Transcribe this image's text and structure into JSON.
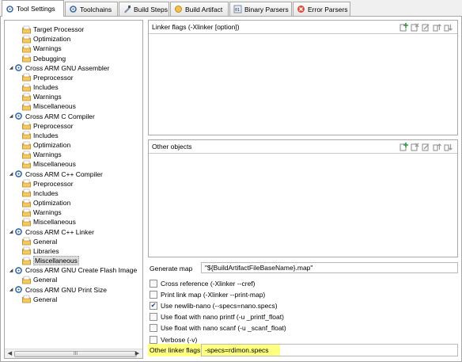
{
  "tabs": [
    {
      "label": "Tool Settings",
      "icon": "tool-settings-icon",
      "active": true
    },
    {
      "label": "Toolchains",
      "icon": "toolchains-icon",
      "active": false
    },
    {
      "label": "Build Steps",
      "icon": "build-steps-icon",
      "active": false
    },
    {
      "label": "Build Artifact",
      "icon": "build-artifact-icon",
      "active": false
    },
    {
      "label": "Binary Parsers",
      "icon": "binary-parsers-icon",
      "active": false
    },
    {
      "label": "Error Parsers",
      "icon": "error-parsers-icon",
      "active": false
    }
  ],
  "tree": [
    {
      "label": "Target Processor",
      "depth": 1,
      "kind": "option"
    },
    {
      "label": "Optimization",
      "depth": 1,
      "kind": "option"
    },
    {
      "label": "Warnings",
      "depth": 1,
      "kind": "option"
    },
    {
      "label": "Debugging",
      "depth": 1,
      "kind": "option"
    },
    {
      "label": "Cross ARM GNU Assembler",
      "depth": 0,
      "kind": "tool"
    },
    {
      "label": "Preprocessor",
      "depth": 1,
      "kind": "option"
    },
    {
      "label": "Includes",
      "depth": 1,
      "kind": "option"
    },
    {
      "label": "Warnings",
      "depth": 1,
      "kind": "option"
    },
    {
      "label": "Miscellaneous",
      "depth": 1,
      "kind": "option"
    },
    {
      "label": "Cross ARM C Compiler",
      "depth": 0,
      "kind": "tool"
    },
    {
      "label": "Preprocessor",
      "depth": 1,
      "kind": "option"
    },
    {
      "label": "Includes",
      "depth": 1,
      "kind": "option"
    },
    {
      "label": "Optimization",
      "depth": 1,
      "kind": "option"
    },
    {
      "label": "Warnings",
      "depth": 1,
      "kind": "option"
    },
    {
      "label": "Miscellaneous",
      "depth": 1,
      "kind": "option"
    },
    {
      "label": "Cross ARM C++ Compiler",
      "depth": 0,
      "kind": "tool"
    },
    {
      "label": "Preprocessor",
      "depth": 1,
      "kind": "option"
    },
    {
      "label": "Includes",
      "depth": 1,
      "kind": "option"
    },
    {
      "label": "Optimization",
      "depth": 1,
      "kind": "option"
    },
    {
      "label": "Warnings",
      "depth": 1,
      "kind": "option"
    },
    {
      "label": "Miscellaneous",
      "depth": 1,
      "kind": "option"
    },
    {
      "label": "Cross ARM C++ Linker",
      "depth": 0,
      "kind": "tool"
    },
    {
      "label": "General",
      "depth": 1,
      "kind": "option"
    },
    {
      "label": "Libraries",
      "depth": 1,
      "kind": "option"
    },
    {
      "label": "Miscellaneous",
      "depth": 1,
      "kind": "option",
      "selected": true
    },
    {
      "label": "Cross ARM GNU Create Flash Image",
      "depth": 0,
      "kind": "tool"
    },
    {
      "label": "General",
      "depth": 1,
      "kind": "option"
    },
    {
      "label": "Cross ARM GNU Print Size",
      "depth": 0,
      "kind": "tool"
    },
    {
      "label": "General",
      "depth": 1,
      "kind": "option"
    }
  ],
  "tree_scroll": {
    "grip": "III"
  },
  "linker_flags": {
    "title": "Linker flags (-Xlinker [option])"
  },
  "other_objects": {
    "title": "Other objects"
  },
  "list_tools": [
    "add-icon",
    "delete-icon",
    "edit-icon",
    "move-up-icon",
    "move-down-icon"
  ],
  "generate_map": {
    "label": "Generate map",
    "value": "\"${BuildArtifactFileBaseName}.map\""
  },
  "checkboxes": [
    {
      "label": "Cross reference (-Xlinker --cref)",
      "checked": false
    },
    {
      "label": "Print link map (-Xlinker --print-map)",
      "checked": false
    },
    {
      "label": "Use newlib-nano (--specs=nano.specs)",
      "checked": true
    },
    {
      "label": "Use float with nano printf (-u _printf_float)",
      "checked": false
    },
    {
      "label": "Use float with nano scanf (-u _scanf_float)",
      "checked": false
    },
    {
      "label": "Verbose (-v)",
      "checked": false
    }
  ],
  "other_linker_flags": {
    "label": "Other linker flags",
    "value": "-specs=rdimon.specs"
  },
  "colors": {
    "highlight": "#ffff80",
    "border": "#a8a8a8",
    "folder": "#e8b34a"
  }
}
